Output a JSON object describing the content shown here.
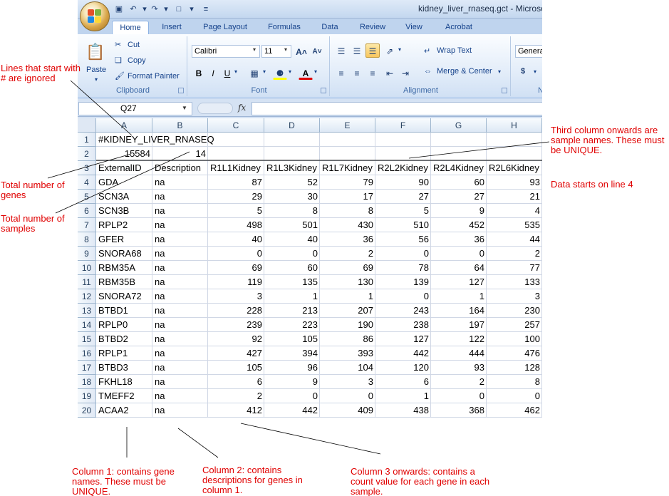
{
  "window": {
    "title": "kidney_liver_rnaseq.gct - Microso"
  },
  "ribbon": {
    "tabs": [
      "Home",
      "Insert",
      "Page Layout",
      "Formulas",
      "Data",
      "Review",
      "View",
      "Acrobat"
    ],
    "clipboard": {
      "paste": "Paste",
      "cut": "Cut",
      "copy": "Copy",
      "format_painter": "Format Painter",
      "label": "Clipboard"
    },
    "font": {
      "name": "Calibri",
      "size": "11",
      "label": "Font",
      "bold": "B",
      "italic": "I",
      "underline": "U"
    },
    "alignment": {
      "wrap": "Wrap Text",
      "merge": "Merge & Center",
      "label": "Alignment"
    },
    "number": {
      "format": "Genera",
      "currency": "$",
      "label": "N"
    }
  },
  "formula_bar": {
    "name_box": "Q27",
    "fx": "fx",
    "formula": ""
  },
  "sheet": {
    "columns": [
      "A",
      "B",
      "C",
      "D",
      "E",
      "F",
      "G",
      "H"
    ],
    "row_numbers": [
      "1",
      "2",
      "3",
      "4",
      "5",
      "6",
      "7",
      "8",
      "9",
      "10",
      "11",
      "12",
      "13",
      "14",
      "15",
      "16",
      "17",
      "18",
      "19",
      "20"
    ],
    "r1": "#KIDNEY_LIVER_RNASEQ",
    "r2": {
      "genes": "15584",
      "samples": "14"
    },
    "header": [
      "ExternalID",
      "Description",
      "R1L1Kidney",
      "R1L3Kidney",
      "R1L7Kidney",
      "R2L2Kidney",
      "R2L4Kidney",
      "R2L6Kidney"
    ],
    "rows": [
      [
        "GDA",
        "na",
        "87",
        "52",
        "79",
        "90",
        "60",
        "93"
      ],
      [
        "SCN3A",
        "na",
        "29",
        "30",
        "17",
        "27",
        "27",
        "21"
      ],
      [
        "SCN3B",
        "na",
        "5",
        "8",
        "8",
        "5",
        "9",
        "4"
      ],
      [
        "RPLP2",
        "na",
        "498",
        "501",
        "430",
        "510",
        "452",
        "535"
      ],
      [
        "GFER",
        "na",
        "40",
        "40",
        "36",
        "56",
        "36",
        "44"
      ],
      [
        "SNORA68",
        "na",
        "0",
        "0",
        "2",
        "0",
        "0",
        "2"
      ],
      [
        "RBM35A",
        "na",
        "69",
        "60",
        "69",
        "78",
        "64",
        "77"
      ],
      [
        "RBM35B",
        "na",
        "119",
        "135",
        "130",
        "139",
        "127",
        "133"
      ],
      [
        "SNORA72",
        "na",
        "3",
        "1",
        "1",
        "0",
        "1",
        "3"
      ],
      [
        "BTBD1",
        "na",
        "228",
        "213",
        "207",
        "243",
        "164",
        "230"
      ],
      [
        "RPLP0",
        "na",
        "239",
        "223",
        "190",
        "238",
        "197",
        "257"
      ],
      [
        "BTBD2",
        "na",
        "92",
        "105",
        "86",
        "127",
        "122",
        "100"
      ],
      [
        "RPLP1",
        "na",
        "427",
        "394",
        "393",
        "442",
        "444",
        "476"
      ],
      [
        "BTBD3",
        "na",
        "105",
        "96",
        "104",
        "120",
        "93",
        "128"
      ],
      [
        "FKHL18",
        "na",
        "6",
        "9",
        "3",
        "6",
        "2",
        "8"
      ],
      [
        "TMEFF2",
        "na",
        "2",
        "0",
        "0",
        "1",
        "0",
        "0"
      ],
      [
        "ACAA2",
        "na",
        "412",
        "442",
        "409",
        "438",
        "368",
        "462"
      ]
    ]
  },
  "annotations": {
    "hash_lines": "Lines that start with # are ignored",
    "total_genes": "Total number of genes",
    "total_samples": "Total number of samples",
    "sample_names": "Third column onwards are sample names. These must be UNIQUE.",
    "data_start": "Data starts on line 4",
    "col1": "Column 1: contains gene names. These must be UNIQUE.",
    "col2": "Column 2: contains descriptions for genes in column 1.",
    "col3": "Column 3 onwards: contains a count value for each gene in each sample."
  },
  "colors": {
    "annotation": "#e00000",
    "ribbon_text": "#15428b"
  }
}
